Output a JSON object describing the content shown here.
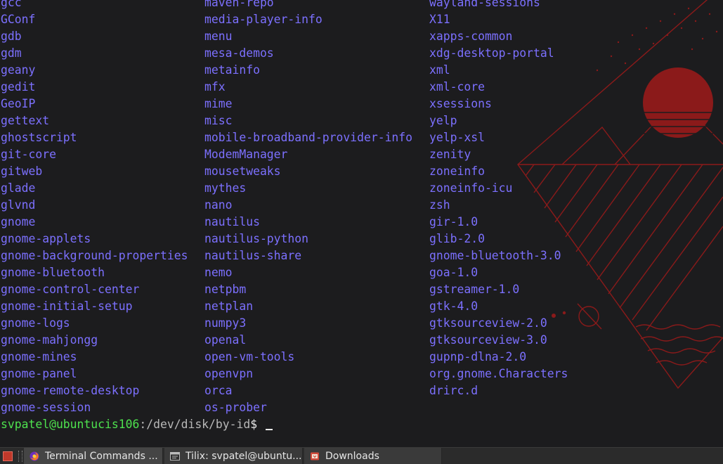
{
  "terminal": {
    "columns": [
      [
        "gcc",
        "GConf",
        "gdb",
        "gdm",
        "geany",
        "gedit",
        "GeoIP",
        "gettext",
        "ghostscript",
        "git-core",
        "gitweb",
        "glade",
        "glvnd",
        "gnome",
        "gnome-applets",
        "gnome-background-properties",
        "gnome-bluetooth",
        "gnome-control-center",
        "gnome-initial-setup",
        "gnome-logs",
        "gnome-mahjongg",
        "gnome-mines",
        "gnome-panel",
        "gnome-remote-desktop",
        "gnome-session"
      ],
      [
        "maven-repo",
        "media-player-info",
        "menu",
        "mesa-demos",
        "metainfo",
        "mfx",
        "mime",
        "misc",
        "mobile-broadband-provider-info",
        "ModemManager",
        "mousetweaks",
        "mythes",
        "nano",
        "nautilus",
        "nautilus-python",
        "nautilus-share",
        "nemo",
        "netpbm",
        "netplan",
        "numpy3",
        "openal",
        "open-vm-tools",
        "openvpn",
        "orca",
        "os-prober"
      ],
      [
        "wayland-sessions",
        "X11",
        "xapps-common",
        "xdg-desktop-portal",
        "xml",
        "xml-core",
        "xsessions",
        "yelp",
        "yelp-xsl",
        "zenity",
        "zoneinfo",
        "zoneinfo-icu",
        "zsh",
        "gir-1.0",
        "glib-2.0",
        "gnome-bluetooth-3.0",
        "goa-1.0",
        "gstreamer-1.0",
        "gtk-4.0",
        "gtksourceview-2.0",
        "gtksourceview-3.0",
        "gupnp-dlna-2.0",
        "org.gnome.Characters",
        "drirc.d"
      ]
    ],
    "prompt": {
      "user_host": "svpatel@ubuntucis106",
      "path": ":/dev/disk/by-id",
      "symbol": "$ "
    },
    "colors": {
      "background": "#1c1c1e",
      "directory": "#7c70ff",
      "prompt_user": "#4ee24e",
      "wallpaper_accent": "#8b1a1a"
    }
  },
  "taskbar": {
    "show_desktop_icon": "show-desktop-icon",
    "tasks": [
      {
        "label": "Terminal Commands ...",
        "icon": "firefox-icon",
        "active": true
      },
      {
        "label": "Tilix: svpatel@ubuntu...",
        "icon": "terminal-window-icon",
        "active": false
      },
      {
        "label": "Downloads",
        "icon": "folder-icon",
        "active": false
      }
    ]
  }
}
